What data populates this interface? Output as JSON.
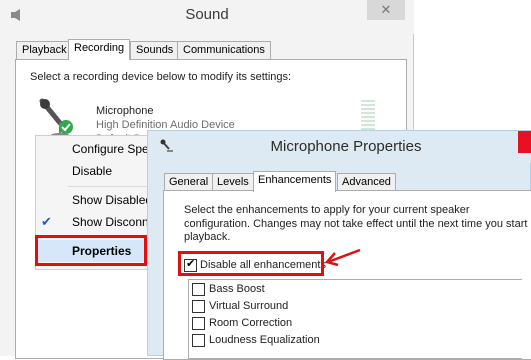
{
  "sound_window": {
    "title": "Sound",
    "close_glyph": "✕",
    "tabs": [
      {
        "label": "Playback",
        "active": false
      },
      {
        "label": "Recording",
        "active": true
      },
      {
        "label": "Sounds",
        "active": false
      },
      {
        "label": "Communications",
        "active": false
      }
    ],
    "instruction": "Select a recording device below to modify its settings:",
    "device": {
      "name": "Microphone",
      "description": "High Definition Audio Device",
      "status": "Default Device",
      "icon": "microphone-icon"
    }
  },
  "context_menu": {
    "items": [
      {
        "label": "Configure Speech Recognition",
        "checked": false
      },
      {
        "label": "Disable",
        "checked": false
      },
      {
        "label": "Show Disabled Devices",
        "checked": false
      },
      {
        "label": "Show Disconnected Devices",
        "checked": true
      },
      {
        "label": "Properties",
        "checked": false,
        "highlighted": true
      }
    ]
  },
  "props_window": {
    "title": "Microphone Properties",
    "tabs": [
      {
        "label": "General",
        "active": false
      },
      {
        "label": "Levels",
        "active": false
      },
      {
        "label": "Enhancements",
        "active": true
      },
      {
        "label": "Advanced",
        "active": false
      }
    ],
    "description": "Select the enhancements to apply for your current speaker configuration. Changes may not take effect until the next time you start playback.",
    "disable_all": {
      "label": "Disable all enhancements",
      "checked": true
    },
    "enhancements": [
      {
        "label": "Bass Boost",
        "checked": false
      },
      {
        "label": "Virtual Surround",
        "checked": false
      },
      {
        "label": "Room Correction",
        "checked": false
      },
      {
        "label": "Loudness Equalization",
        "checked": false
      }
    ]
  },
  "colors": {
    "highlight_red": "#e01010",
    "menu_highlight": "#d5e7f8",
    "props_title_bg": "#ddeaf4"
  }
}
